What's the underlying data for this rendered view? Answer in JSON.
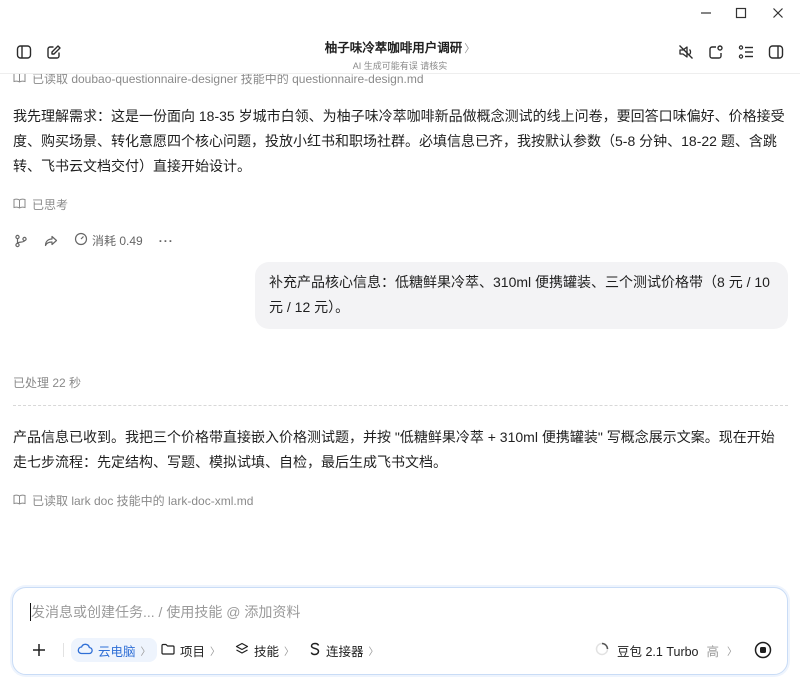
{
  "window": {
    "minimize_icon": "minimize-icon",
    "maximize_icon": "maximize-icon",
    "close_icon": "close-icon"
  },
  "header": {
    "title": "柚子味冷萃咖啡用户调研",
    "title_chevron": "〉",
    "subtitle": "AI 生成可能有误 请核实"
  },
  "chat": {
    "cut_line": "已读取 doubao-questionnaire-designer 技能中的 questionnaire-design.md",
    "assistant_msg_1": "我先理解需求：这是一份面向 18-35 岁城市白领、为柚子味冷萃咖啡新品做概念测试的线上问卷，要回答口味偏好、价格接受度、购买场景、转化意愿四个核心问题，投放小红书和职场社群。必填信息已齐，我按默认参数（5-8 分钟、18-22 题、含跳转、飞书云文档交付）直接开始设计。",
    "thought_label": "已思考",
    "cost_label": "消耗 0.49",
    "more_label": "···",
    "user_msg": "补充产品核心信息：低糖鲜果冷萃、310ml 便携罐装、三个测试价格带（8 元 / 10 元 / 12 元）。",
    "processed_label": "已处理 22 秒",
    "assistant_msg_2": "产品信息已收到。我把三个价格带直接嵌入价格测试题，并按 \"低糖鲜果冷萃 + 310ml 便携罐装\" 写概念展示文案。现在开始走七步流程：先定结构、写题、模拟试填、自检，最后生成飞书文档。",
    "read_label": "已读取 lark doc 技能中的 lark-doc-xml.md"
  },
  "composer": {
    "placeholder": "发消息或创建任务... / 使用技能 @ 添加资料",
    "tools": {
      "cloud_pc": "云电脑",
      "project": "项目",
      "skills": "技能",
      "connector": "连接器"
    },
    "chevron": "〉",
    "model_name": "豆包 2.1 Turbo",
    "model_tier": "高",
    "accent_color": "#2f6fd6"
  }
}
